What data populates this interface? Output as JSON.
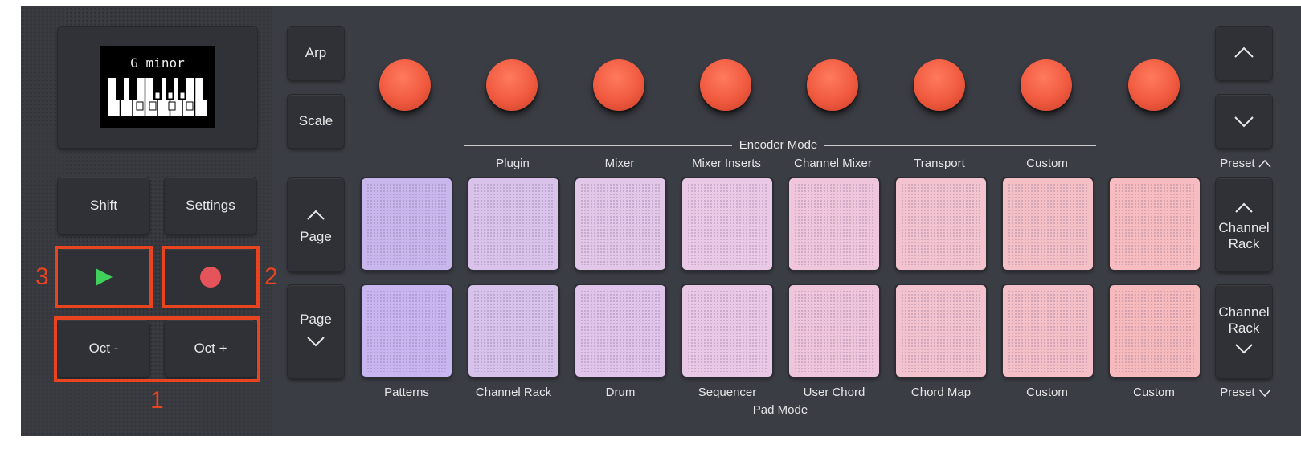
{
  "display": {
    "text": "G minor"
  },
  "left_buttons": {
    "shift": "Shift",
    "settings": "Settings",
    "oct_down": "Oct -",
    "oct_up": "Oct +"
  },
  "side_buttons": {
    "arp": "Arp",
    "scale": "Scale",
    "page": "Page"
  },
  "encoder_mode": {
    "title": "Encoder Mode",
    "modes": [
      "Plugin",
      "Mixer",
      "Mixer Inserts",
      "Channel Mixer",
      "Transport",
      "Custom"
    ]
  },
  "pad_mode": {
    "title": "Pad Mode",
    "modes": [
      "Patterns",
      "Channel Rack",
      "Drum",
      "Sequencer",
      "User Chord",
      "Chord Map",
      "Custom",
      "Custom"
    ]
  },
  "right_buttons": {
    "preset_up": "Preset",
    "preset_down": "Preset",
    "channel_rack_line1": "Channel",
    "channel_rack_line2": "Rack"
  },
  "callouts": [
    "1",
    "2",
    "3"
  ],
  "colors": {
    "knob": "#f05a3f",
    "play": "#3fd15a",
    "record": "#e4545a",
    "highlight": "#e8441f"
  }
}
